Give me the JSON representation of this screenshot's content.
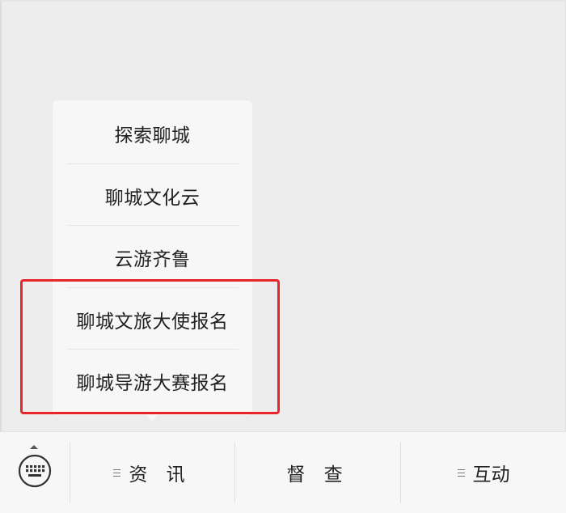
{
  "popup_menu": {
    "items": [
      {
        "label": "探索聊城"
      },
      {
        "label": "聊城文化云"
      },
      {
        "label": "云游齐鲁"
      },
      {
        "label": "聊城文旅大使报名"
      },
      {
        "label": "聊城导游大赛报名"
      }
    ]
  },
  "highlight": {
    "color": "#e8262a"
  },
  "bottom_bar": {
    "keyboard_icon": "keyboard-icon",
    "tabs": [
      {
        "label": "资 讯",
        "icon": "menu-lines-icon"
      },
      {
        "label": "督 查"
      },
      {
        "label": "互动",
        "icon": "menu-lines-icon"
      }
    ]
  }
}
